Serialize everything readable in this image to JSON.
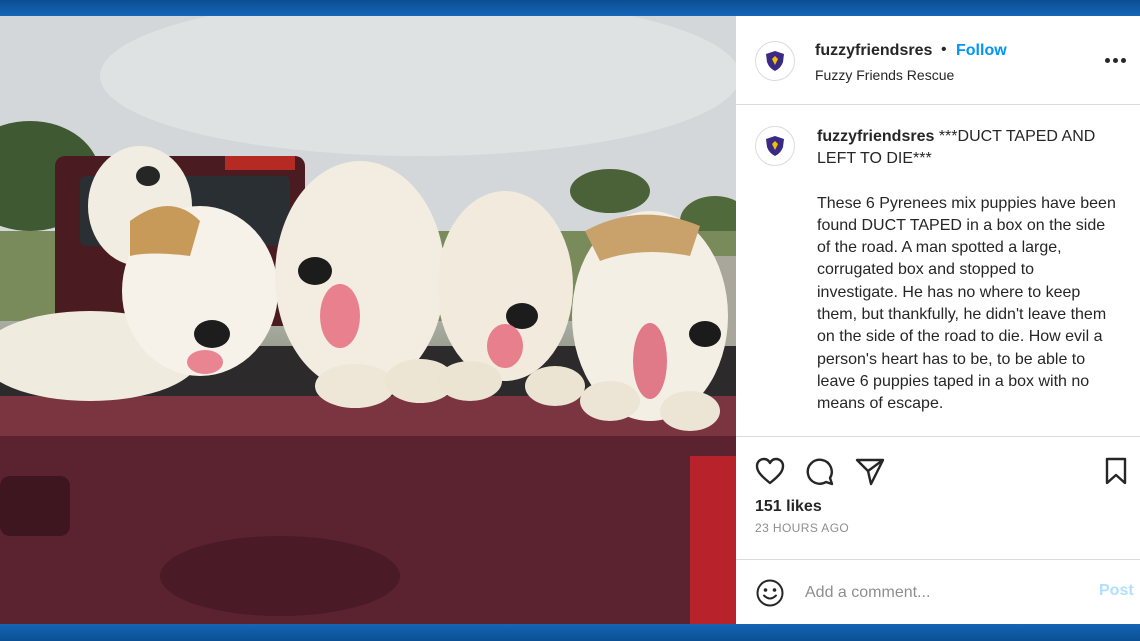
{
  "post": {
    "username": "fuzzyfriendsres",
    "separator": "•",
    "follow_label": "Follow",
    "display_name": "Fuzzy Friends Rescue",
    "caption_headline": "***DUCT TAPED AND LEFT TO DIE***",
    "caption_body": "These 6 Pyrenees mix puppies have been found DUCT TAPED in a box on the side of the road. A man spotted a large, corrugated box and stopped to investigate. He has no where to keep them, but thankfully, he didn't leave them on the side of the road to die. How evil a person's heart has to be, to be able to leave 6 puppies taped in a box with no means of escape.",
    "likes": "151 likes",
    "timestamp": "23 HOURS AGO"
  },
  "comment": {
    "placeholder": "Add a comment...",
    "post_label": "Post"
  },
  "icons": {
    "more": "more-options-icon",
    "like": "heart-icon",
    "comment": "comment-icon",
    "share": "send-icon",
    "save": "bookmark-icon",
    "emoji": "emoji-icon",
    "avatar": "shield-logo-icon"
  },
  "colors": {
    "frame": "#0d5fa8",
    "link": "#0095f6",
    "post_disabled": "#b2dffc",
    "logo": "#3b2a84",
    "logo_accent": "#f2c200"
  }
}
